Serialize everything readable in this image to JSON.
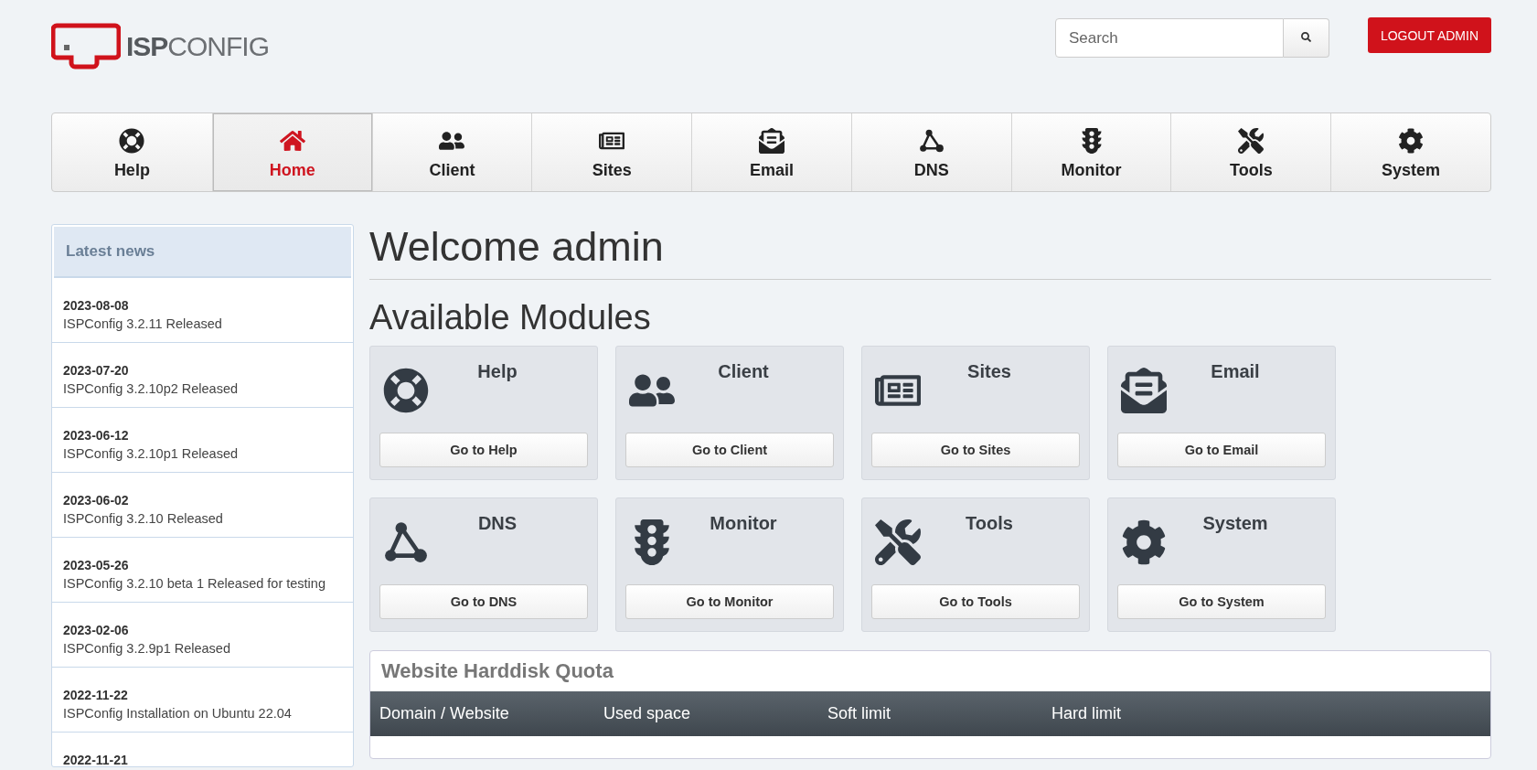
{
  "logo": {
    "strong": "ISP",
    "light": "CONFIG"
  },
  "search": {
    "placeholder": "Search"
  },
  "logout": "LOGOUT ADMIN",
  "nav": [
    {
      "label": "Help",
      "selected": false
    },
    {
      "label": "Home",
      "selected": true
    },
    {
      "label": "Client",
      "selected": false
    },
    {
      "label": "Sites",
      "selected": false
    },
    {
      "label": "Email",
      "selected": false
    },
    {
      "label": "DNS",
      "selected": false
    },
    {
      "label": "Monitor",
      "selected": false
    },
    {
      "label": "Tools",
      "selected": false
    },
    {
      "label": "System",
      "selected": false
    }
  ],
  "sidebar": {
    "title": "Latest news",
    "items": [
      {
        "date": "2023-08-08",
        "title": "ISPConfig 3.2.11 Released"
      },
      {
        "date": "2023-07-20",
        "title": "ISPConfig 3.2.10p2 Released"
      },
      {
        "date": "2023-06-12",
        "title": "ISPConfig 3.2.10p1 Released"
      },
      {
        "date": "2023-06-02",
        "title": "ISPConfig 3.2.10 Released"
      },
      {
        "date": "2023-05-26",
        "title": "ISPConfig 3.2.10 beta 1 Released for testing"
      },
      {
        "date": "2023-02-06",
        "title": "ISPConfig 3.2.9p1 Released"
      },
      {
        "date": "2022-11-22",
        "title": "ISPConfig Installation on Ubuntu 22.04"
      },
      {
        "date": "2022-11-21"
      }
    ]
  },
  "heading": "Welcome admin",
  "modules_heading": "Available Modules",
  "modules": [
    {
      "title": "Help",
      "button": "Go to Help"
    },
    {
      "title": "Client",
      "button": "Go to Client"
    },
    {
      "title": "Sites",
      "button": "Go to Sites"
    },
    {
      "title": "Email",
      "button": "Go to Email"
    },
    {
      "title": "DNS",
      "button": "Go to DNS"
    },
    {
      "title": "Monitor",
      "button": "Go to Monitor"
    },
    {
      "title": "Tools",
      "button": "Go to Tools"
    },
    {
      "title": "System",
      "button": "Go to System"
    }
  ],
  "quota": {
    "title": "Website Harddisk Quota",
    "columns": [
      "Domain / Website",
      "Used space",
      "Soft limit",
      "Hard limit"
    ]
  }
}
